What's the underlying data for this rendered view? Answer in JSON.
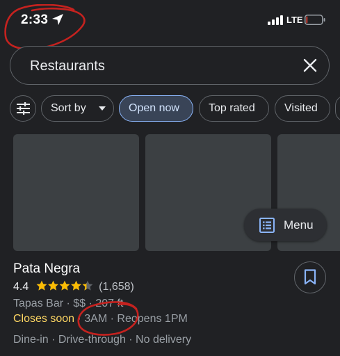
{
  "status_bar": {
    "time": "2:33",
    "network": "LTE",
    "battery_level": 0.08
  },
  "search": {
    "query": "Restaurants"
  },
  "filters": {
    "sort_by": "Sort by",
    "open_now": "Open now",
    "top_rated": "Top rated",
    "visited": "Visited"
  },
  "menu_button": {
    "label": "Menu"
  },
  "place": {
    "name": "Pata Negra",
    "rating": "4.4",
    "rating_value": 4.4,
    "reviews": "(1,658)",
    "category": "Tapas Bar",
    "price": "$$",
    "distance": "207 ft",
    "sep": "·",
    "closes_label": "Closes soon",
    "close_time": "3AM",
    "reopens": "Reopens 1PM",
    "services": "Dine-in · Drive-through · No delivery"
  },
  "colors": {
    "background": "#202124",
    "accent": "#8ab4f8",
    "warning": "#fdd663",
    "star": "#fbbc04",
    "annotation": "#c5221f"
  }
}
